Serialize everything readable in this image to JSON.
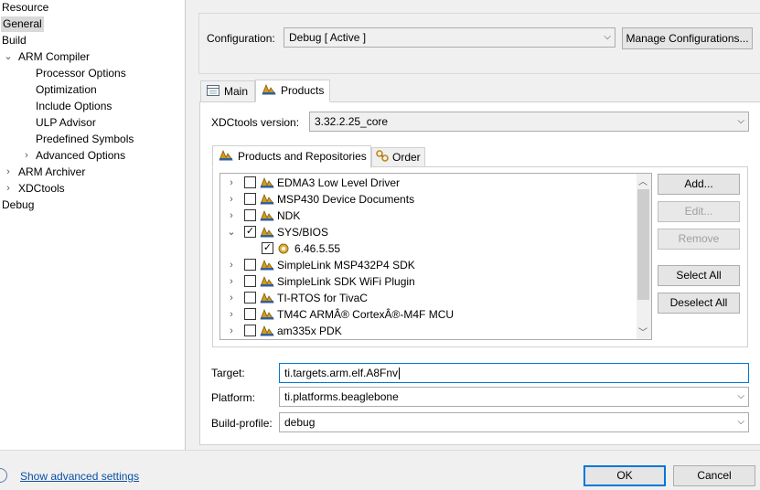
{
  "left_tree": {
    "items": [
      {
        "label": "Resource"
      },
      {
        "label": "General"
      },
      {
        "label": "Build"
      },
      {
        "label": "ARM Compiler",
        "twisty": "⌄"
      },
      {
        "label": "Processor Options"
      },
      {
        "label": "Optimization"
      },
      {
        "label": "Include Options"
      },
      {
        "label": "ULP Advisor"
      },
      {
        "label": "Predefined Symbols"
      },
      {
        "label": "Advanced Options",
        "twisty": "›"
      },
      {
        "label": "ARM Archiver",
        "twisty": "›"
      },
      {
        "label": "XDCtools",
        "twisty": "›"
      },
      {
        "label": "Debug"
      }
    ]
  },
  "configuration": {
    "label": "Configuration:",
    "value": "Debug  [ Active ]",
    "manage_button": "Manage Configurations..."
  },
  "tabs": [
    {
      "label": "Main",
      "icon": "main-tab-icon"
    },
    {
      "label": "Products",
      "icon": "products-icon"
    }
  ],
  "xdctools": {
    "label": "XDCtools version:",
    "value": "3.32.2.25_core"
  },
  "inner_tabs": [
    {
      "label": "Products and Repositories",
      "icon": "products-icon"
    },
    {
      "label": "Order",
      "icon": "order-icon"
    }
  ],
  "products": [
    {
      "label": "EDMA3 Low Level Driver",
      "checked": false,
      "expand": "›"
    },
    {
      "label": "MSP430 Device Documents",
      "checked": false,
      "expand": "›"
    },
    {
      "label": "NDK",
      "checked": false,
      "expand": "›"
    },
    {
      "label": "SYS/BIOS",
      "checked": true,
      "expand": "⌄"
    },
    {
      "label": "6.46.5.55",
      "checked": true,
      "expand": ""
    },
    {
      "label": "SimpleLink MSP432P4 SDK",
      "checked": false,
      "expand": "›"
    },
    {
      "label": "SimpleLink SDK WiFi Plugin",
      "checked": false,
      "expand": "›"
    },
    {
      "label": "TI-RTOS for TivaC",
      "checked": false,
      "expand": "›"
    },
    {
      "label": "TM4C ARMÂ® CortexÂ®-M4F MCU",
      "checked": false,
      "expand": "›"
    },
    {
      "label": "am335x PDK",
      "checked": false,
      "expand": "›"
    }
  ],
  "side_buttons": {
    "add": "Add...",
    "edit": "Edit...",
    "remove": "Remove",
    "select_all": "Select All",
    "deselect_all": "Deselect All"
  },
  "target": {
    "label": "Target:",
    "value": "ti.targets.arm.elf.A8Fnv"
  },
  "platform": {
    "label": "Platform:",
    "value": "ti.platforms.beaglebone"
  },
  "build_profile": {
    "label": "Build-profile:",
    "value": "debug"
  },
  "footer": {
    "advanced_link": "Show advanced settings",
    "ok": "OK",
    "cancel": "Cancel"
  }
}
